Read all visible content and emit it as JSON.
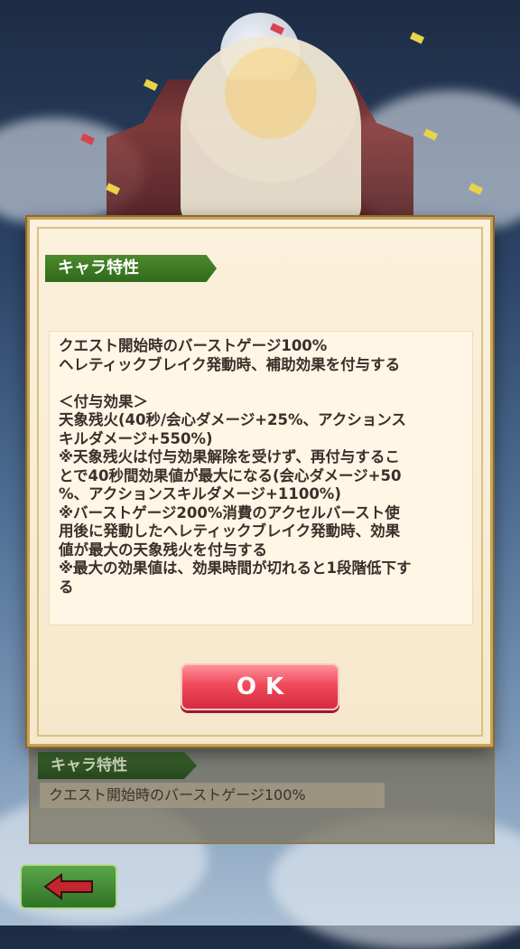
{
  "popup": {
    "header": "キャラ特性",
    "lines": [
      "クエスト開始時のバーストゲージ100%",
      "ヘレティックブレイク発動時、補助効果を付与する",
      "",
      "＜付与効果＞",
      "天象残火(40秒/会心ダメージ+25%、アクションス",
      "キルダメージ+550%)",
      "※天象残火は付与効果解除を受けず、再付与するこ",
      "とで40秒間効果値が最大になる(会心ダメージ+50",
      "%、アクションスキルダメージ+1100%)",
      "※バーストゲージ200%消費のアクセルバースト使",
      "用後に発動したヘレティックブレイク発動時、効果",
      "値が最大の天象残火を付与する",
      "※最大の効果値は、効果時間が切れると1段階低下す",
      "る"
    ],
    "ok_label": "OK"
  },
  "background_panel": {
    "header": "キャラ特性",
    "summary": "クエスト開始時のバーストゲージ100%"
  },
  "icons": {
    "back": "left-arrow-icon"
  }
}
